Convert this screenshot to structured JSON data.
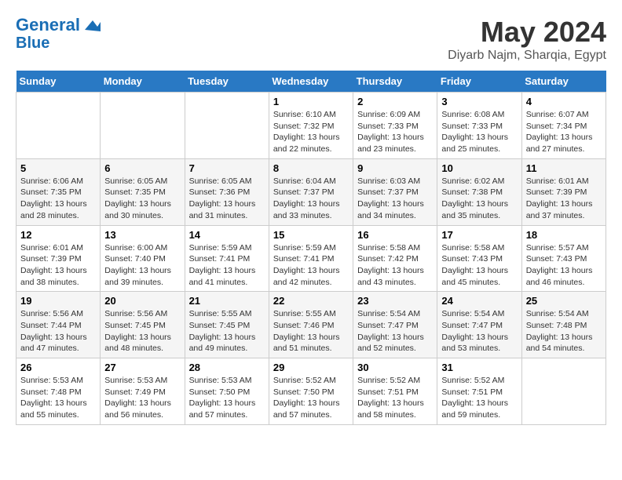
{
  "header": {
    "logo_line1": "General",
    "logo_line2": "Blue",
    "title": "May 2024",
    "subtitle": "Diyarb Najm, Sharqia, Egypt"
  },
  "days_of_week": [
    "Sunday",
    "Monday",
    "Tuesday",
    "Wednesday",
    "Thursday",
    "Friday",
    "Saturday"
  ],
  "weeks": [
    [
      {
        "date": "",
        "info": ""
      },
      {
        "date": "",
        "info": ""
      },
      {
        "date": "",
        "info": ""
      },
      {
        "date": "1",
        "info": "Sunrise: 6:10 AM\nSunset: 7:32 PM\nDaylight: 13 hours and 22 minutes."
      },
      {
        "date": "2",
        "info": "Sunrise: 6:09 AM\nSunset: 7:33 PM\nDaylight: 13 hours and 23 minutes."
      },
      {
        "date": "3",
        "info": "Sunrise: 6:08 AM\nSunset: 7:33 PM\nDaylight: 13 hours and 25 minutes."
      },
      {
        "date": "4",
        "info": "Sunrise: 6:07 AM\nSunset: 7:34 PM\nDaylight: 13 hours and 27 minutes."
      }
    ],
    [
      {
        "date": "5",
        "info": "Sunrise: 6:06 AM\nSunset: 7:35 PM\nDaylight: 13 hours and 28 minutes."
      },
      {
        "date": "6",
        "info": "Sunrise: 6:05 AM\nSunset: 7:35 PM\nDaylight: 13 hours and 30 minutes."
      },
      {
        "date": "7",
        "info": "Sunrise: 6:05 AM\nSunset: 7:36 PM\nDaylight: 13 hours and 31 minutes."
      },
      {
        "date": "8",
        "info": "Sunrise: 6:04 AM\nSunset: 7:37 PM\nDaylight: 13 hours and 33 minutes."
      },
      {
        "date": "9",
        "info": "Sunrise: 6:03 AM\nSunset: 7:37 PM\nDaylight: 13 hours and 34 minutes."
      },
      {
        "date": "10",
        "info": "Sunrise: 6:02 AM\nSunset: 7:38 PM\nDaylight: 13 hours and 35 minutes."
      },
      {
        "date": "11",
        "info": "Sunrise: 6:01 AM\nSunset: 7:39 PM\nDaylight: 13 hours and 37 minutes."
      }
    ],
    [
      {
        "date": "12",
        "info": "Sunrise: 6:01 AM\nSunset: 7:39 PM\nDaylight: 13 hours and 38 minutes."
      },
      {
        "date": "13",
        "info": "Sunrise: 6:00 AM\nSunset: 7:40 PM\nDaylight: 13 hours and 39 minutes."
      },
      {
        "date": "14",
        "info": "Sunrise: 5:59 AM\nSunset: 7:41 PM\nDaylight: 13 hours and 41 minutes."
      },
      {
        "date": "15",
        "info": "Sunrise: 5:59 AM\nSunset: 7:41 PM\nDaylight: 13 hours and 42 minutes."
      },
      {
        "date": "16",
        "info": "Sunrise: 5:58 AM\nSunset: 7:42 PM\nDaylight: 13 hours and 43 minutes."
      },
      {
        "date": "17",
        "info": "Sunrise: 5:58 AM\nSunset: 7:43 PM\nDaylight: 13 hours and 45 minutes."
      },
      {
        "date": "18",
        "info": "Sunrise: 5:57 AM\nSunset: 7:43 PM\nDaylight: 13 hours and 46 minutes."
      }
    ],
    [
      {
        "date": "19",
        "info": "Sunrise: 5:56 AM\nSunset: 7:44 PM\nDaylight: 13 hours and 47 minutes."
      },
      {
        "date": "20",
        "info": "Sunrise: 5:56 AM\nSunset: 7:45 PM\nDaylight: 13 hours and 48 minutes."
      },
      {
        "date": "21",
        "info": "Sunrise: 5:55 AM\nSunset: 7:45 PM\nDaylight: 13 hours and 49 minutes."
      },
      {
        "date": "22",
        "info": "Sunrise: 5:55 AM\nSunset: 7:46 PM\nDaylight: 13 hours and 51 minutes."
      },
      {
        "date": "23",
        "info": "Sunrise: 5:54 AM\nSunset: 7:47 PM\nDaylight: 13 hours and 52 minutes."
      },
      {
        "date": "24",
        "info": "Sunrise: 5:54 AM\nSunset: 7:47 PM\nDaylight: 13 hours and 53 minutes."
      },
      {
        "date": "25",
        "info": "Sunrise: 5:54 AM\nSunset: 7:48 PM\nDaylight: 13 hours and 54 minutes."
      }
    ],
    [
      {
        "date": "26",
        "info": "Sunrise: 5:53 AM\nSunset: 7:48 PM\nDaylight: 13 hours and 55 minutes."
      },
      {
        "date": "27",
        "info": "Sunrise: 5:53 AM\nSunset: 7:49 PM\nDaylight: 13 hours and 56 minutes."
      },
      {
        "date": "28",
        "info": "Sunrise: 5:53 AM\nSunset: 7:50 PM\nDaylight: 13 hours and 57 minutes."
      },
      {
        "date": "29",
        "info": "Sunrise: 5:52 AM\nSunset: 7:50 PM\nDaylight: 13 hours and 57 minutes."
      },
      {
        "date": "30",
        "info": "Sunrise: 5:52 AM\nSunset: 7:51 PM\nDaylight: 13 hours and 58 minutes."
      },
      {
        "date": "31",
        "info": "Sunrise: 5:52 AM\nSunset: 7:51 PM\nDaylight: 13 hours and 59 minutes."
      },
      {
        "date": "",
        "info": ""
      }
    ]
  ]
}
